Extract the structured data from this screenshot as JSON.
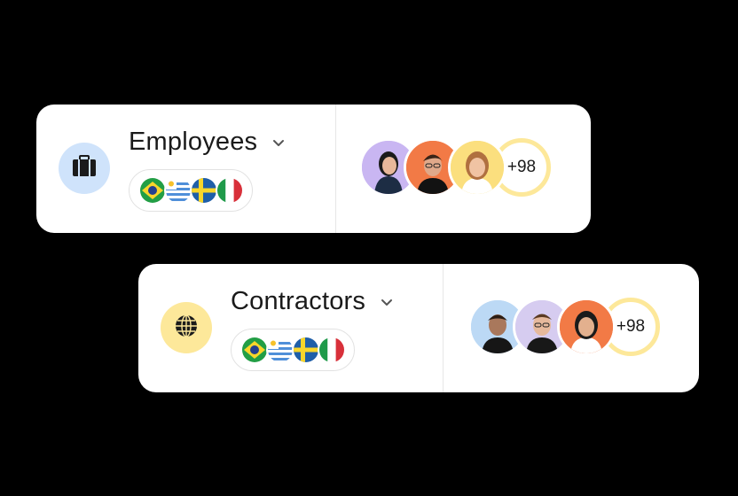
{
  "cards": [
    {
      "id": "employees",
      "title": "Employees",
      "icon": "briefcase-icon",
      "badge_color": "#cfe3fb",
      "flags": [
        "brazil",
        "uruguay",
        "sweden",
        "italy"
      ],
      "avatar_colors": [
        "#c9b6f2",
        "#f27a46",
        "#fbdf7e"
      ],
      "more_count": "+98"
    },
    {
      "id": "contractors",
      "title": "Contractors",
      "icon": "globe-icon",
      "badge_color": "#fde89a",
      "flags": [
        "brazil",
        "uruguay",
        "sweden",
        "italy"
      ],
      "avatar_colors": [
        "#bcd9f5",
        "#d6ccf0",
        "#f27a46"
      ],
      "more_count": "+98"
    }
  ]
}
